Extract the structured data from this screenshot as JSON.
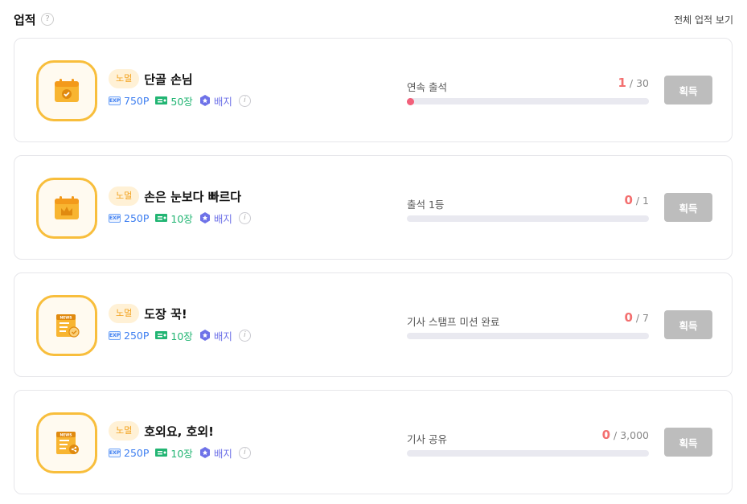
{
  "header": {
    "title": "업적",
    "help_icon": "?",
    "view_all": "전체 업적 보기"
  },
  "achievements": [
    {
      "icon": "calendar-check-icon",
      "tier": "노멀",
      "title": "단골 손님",
      "exp_label": "EXP",
      "exp": "750P",
      "tickets": "50장",
      "badge": "배지",
      "progress_label": "연속 출석",
      "current": "1",
      "total": "/ 30",
      "progress": 0.033,
      "button": "획득"
    },
    {
      "icon": "calendar-crown-icon",
      "tier": "노멀",
      "title": "손은 눈보다 빠르다",
      "exp_label": "EXP",
      "exp": "250P",
      "tickets": "10장",
      "badge": "배지",
      "progress_label": "출석 1등",
      "current": "0",
      "total": "/ 1",
      "progress": 0,
      "button": "획득"
    },
    {
      "icon": "news-stamp-icon",
      "tier": "노멀",
      "title": "도장 꾹!",
      "exp_label": "EXP",
      "exp": "250P",
      "tickets": "10장",
      "badge": "배지",
      "progress_label": "기사 스탬프 미션 완료",
      "current": "0",
      "total": "/ 7",
      "progress": 0,
      "button": "획득"
    },
    {
      "icon": "news-share-icon",
      "tier": "노멀",
      "title": "호외요, 호외!",
      "exp_label": "EXP",
      "exp": "250P",
      "tickets": "10장",
      "badge": "배지",
      "progress_label": "기사 공유",
      "current": "0",
      "total": "/ 3,000",
      "progress": 0,
      "button": "획득"
    }
  ],
  "colors": {
    "accent": "#f8be3c",
    "exp": "#3d7ef0",
    "ticket": "#22b573",
    "badge": "#6e72e8",
    "progress": "#f2607a",
    "button_disabled": "#bdbdbd"
  }
}
